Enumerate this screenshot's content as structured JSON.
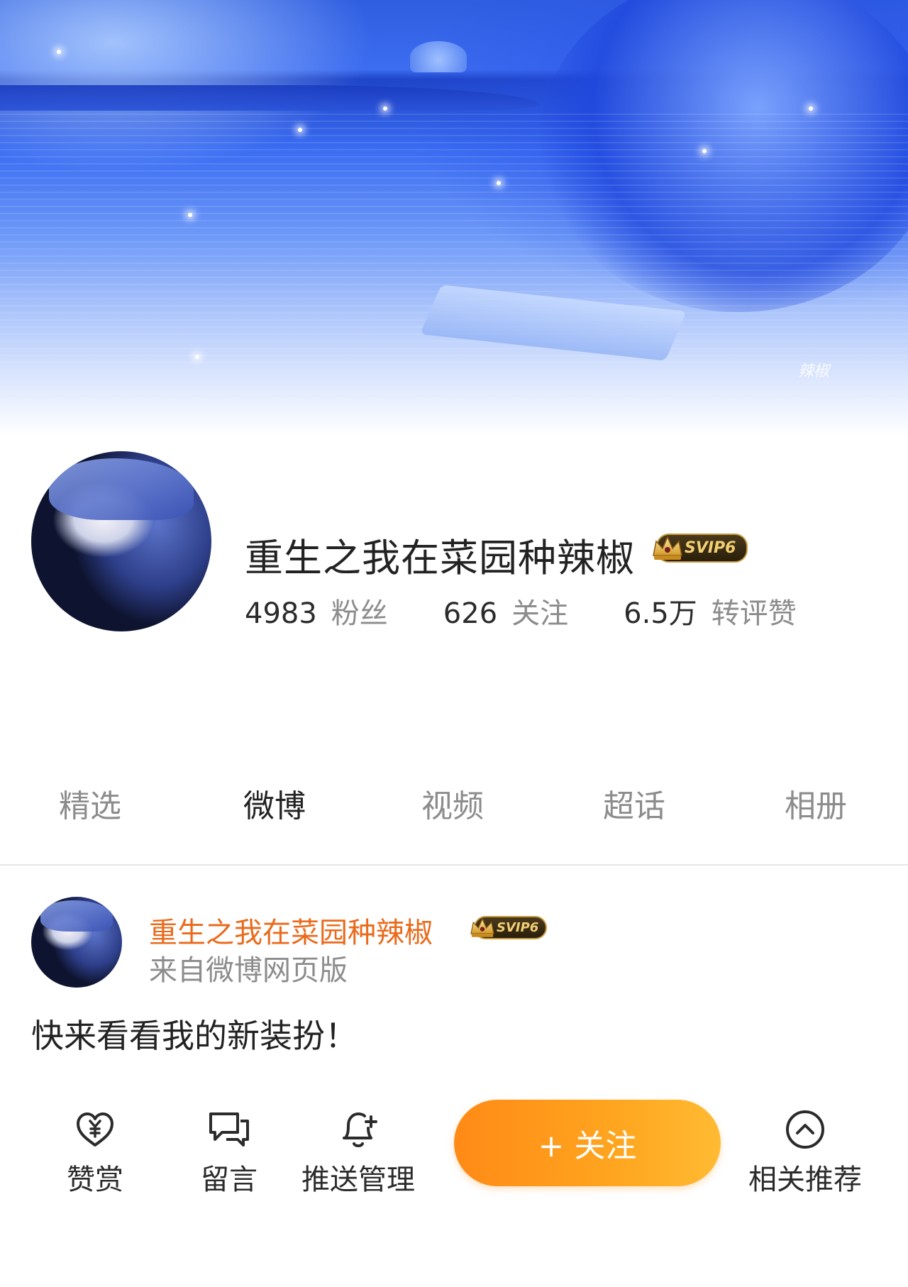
{
  "banner": {
    "signature": "辣椒"
  },
  "profile": {
    "name": "重生之我在菜园种辣椒",
    "vip_badge": "SVIP6",
    "stats": [
      {
        "value": "4983",
        "label": "粉丝"
      },
      {
        "value": "626",
        "label": "关注"
      },
      {
        "value": "6.5万",
        "label": "转评赞"
      }
    ]
  },
  "tabs": [
    {
      "label": "精选",
      "active": false
    },
    {
      "label": "微博",
      "active": true
    },
    {
      "label": "视频",
      "active": false
    },
    {
      "label": "超话",
      "active": false
    },
    {
      "label": "相册",
      "active": false
    }
  ],
  "post": {
    "author": "重生之我在菜园种辣椒",
    "vip_badge": "SVIP6",
    "source": "来自微博网页版",
    "text": "快来看看我的新装扮！"
  },
  "bottom_bar": {
    "reward": {
      "label": "赞赏",
      "icon": "heart-yen-icon"
    },
    "comment": {
      "label": "留言",
      "icon": "chat-bubbles-icon"
    },
    "push": {
      "label": "推送管理",
      "icon": "bell-plus-icon"
    },
    "follow": {
      "label": "+ 关注"
    },
    "related": {
      "label": "相关推荐",
      "icon": "chevron-up-circle-icon"
    }
  },
  "colors": {
    "accent_orange": "#ff9a1c",
    "name_orange": "#ea6a1b",
    "muted_text": "#8c8c8c"
  }
}
